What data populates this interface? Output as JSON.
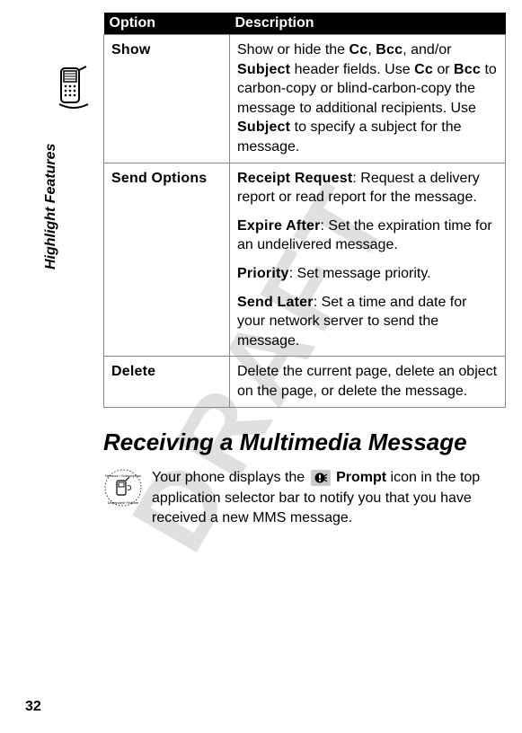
{
  "watermark": "DRAFT",
  "side_label": "Highlight Features",
  "page_number": "32",
  "table": {
    "headers": {
      "option": "Option",
      "description": "Description"
    },
    "rows": [
      {
        "option": "Show",
        "desc_parts": {
          "p1a": "Show or hide the ",
          "b1": "Cc",
          "p1b": ", ",
          "b2": "Bcc",
          "p1c": ", and/or ",
          "b3": "Subject",
          "p1d": " header fields. Use ",
          "b4": "Cc",
          "p1e": " or ",
          "b5": "Bcc",
          "p1f": " to carbon-copy or blind-carbon-copy the message to additional recipients. Use ",
          "b6": "Subject",
          "p1g": " to specify a subject for the message."
        }
      },
      {
        "option": "Send Options",
        "blocks": [
          {
            "label": "Receipt Request",
            "text": ": Request a delivery report or read report for the message."
          },
          {
            "label": "Expire After",
            "text": ": Set the expiration time for an undelivered message."
          },
          {
            "label": "Priority",
            "text": ": Set message priority."
          },
          {
            "label": "Send Later",
            "text": ": Set a time and date for your network server to send the message."
          }
        ]
      },
      {
        "option": "Delete",
        "desc_plain": "Delete the current page, delete an object on the page, or delete the message."
      }
    ]
  },
  "section_heading": "Receiving a Multimedia Message",
  "paragraph": {
    "pre": "Your phone displays the ",
    "bold": "Prompt",
    "post": " icon in the top application selector bar to notify you that you have received a new MMS message."
  }
}
